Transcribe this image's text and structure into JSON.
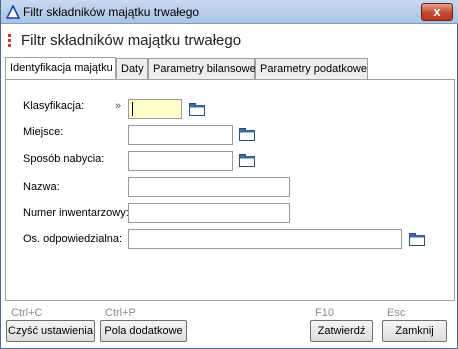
{
  "window": {
    "title": "Filtr składników majątku trwałego",
    "close_label": "x"
  },
  "header": {
    "heading": "Filtr składników majątku trwałego"
  },
  "tabs": [
    {
      "label": "Identyfikacja majątku",
      "active": true
    },
    {
      "label": "Daty",
      "active": false
    },
    {
      "label": "Parametry bilansowe",
      "active": false
    },
    {
      "label": "Parametry podatkowe",
      "active": false
    }
  ],
  "form": {
    "klasyfikacja": {
      "label": "Klasyfikacja:",
      "value": "",
      "marker": "»"
    },
    "miejsce": {
      "label": "Miejsce:",
      "value": ""
    },
    "sposob_nabycia": {
      "label": "Sposób nabycia:",
      "value": ""
    },
    "nazwa": {
      "label": "Nazwa:",
      "value": ""
    },
    "numer_inwentarzowy": {
      "label": "Numer inwentarzowy:",
      "value": ""
    },
    "os_odpowiedzialna": {
      "label": "Os. odpowiedzialna:",
      "value": ""
    }
  },
  "footer": {
    "clear": {
      "shortcut": "Ctrl+C",
      "label": "Czyść ustawienia"
    },
    "extra": {
      "shortcut": "Ctrl+P",
      "label": "Pola dodatkowe"
    },
    "confirm": {
      "shortcut": "F10",
      "label": "Zatwierdź"
    },
    "close": {
      "shortcut": "Esc",
      "label": "Zamknij"
    }
  },
  "colors": {
    "focused_field": "#ffffcc",
    "close_button": "#c24a2f",
    "header_dots": "#dd3333"
  },
  "icons": {
    "app": "blue-triangle-icon",
    "lookup": "folder-icon"
  }
}
